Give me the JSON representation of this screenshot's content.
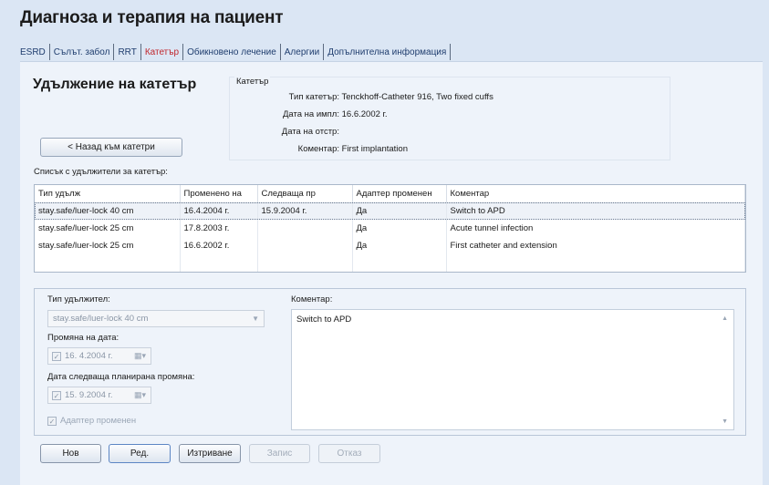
{
  "app": {
    "title": "Диагноза и терапия на пациент"
  },
  "tabs": [
    {
      "label": "ESRD",
      "active": false
    },
    {
      "label": "Сълът. забол",
      "active": false
    },
    {
      "label": "RRT",
      "active": false
    },
    {
      "label": "Катетър",
      "active": true
    },
    {
      "label": "Обикновено лечение",
      "active": false
    },
    {
      "label": "Алергии",
      "active": false
    },
    {
      "label": "Допълнителна информация",
      "active": false
    }
  ],
  "section": {
    "title": "Удължение на катетър",
    "back_label": "< Назад към катетри"
  },
  "catheter_info": {
    "legend": "Катетър",
    "type_label": "Тип катетър:",
    "type_value": "Tenckhoff-Catheter 916, Two fixed cuffs",
    "impl_label": "Дата на импл:",
    "impl_value": "16.6.2002 г.",
    "removal_label": "Дата на отстр:",
    "removal_value": "",
    "comment_label": "Коментар:",
    "comment_value": "First implantation"
  },
  "extensions_list": {
    "caption": "Списък с удължители за катетър:",
    "columns": [
      "Тип удълж",
      "Променено на",
      "Следваща пр",
      "Адаптер променен",
      "Коментар"
    ],
    "rows": [
      [
        "stay.safe/luer-lock 40 cm",
        "16.4.2004 г.",
        "15.9.2004 г.",
        "Да",
        "Switch to APD"
      ],
      [
        "stay.safe/luer-lock 25 cm",
        "17.8.2003 г.",
        "",
        "Да",
        "Acute tunnel infection"
      ],
      [
        "stay.safe/luer-lock 25 cm",
        "16.6.2002 г.",
        "",
        "Да",
        "First catheter and extension"
      ]
    ],
    "selected_row": 0
  },
  "detail": {
    "type_label": "Тип удължител:",
    "type_value": "stay.safe/luer-lock 40 cm",
    "change_date_label": "Промяна на дата:",
    "change_date_value": "16.  4.2004 г.",
    "next_change_label": "Дата следваща планирана промяна:",
    "next_change_value": "15.  9.2004 г.",
    "adapter_label": "Адаптер променен",
    "adapter_checked": true,
    "comment_label": "Коментар:",
    "comment_value": "Switch to APD"
  },
  "buttons": {
    "new": "Нов",
    "edit": "Ред.",
    "delete": "Изтриване",
    "save": "Запис",
    "cancel": "Отказ"
  },
  "icons": {
    "dropdown": "chevron-down-icon",
    "calendar": "calendar-icon",
    "checkbox": "checkbox-icon"
  },
  "colors": {
    "active_tab": "#c0272d",
    "tab_text": "#1f3d6e",
    "background": "#dbe6f4"
  }
}
